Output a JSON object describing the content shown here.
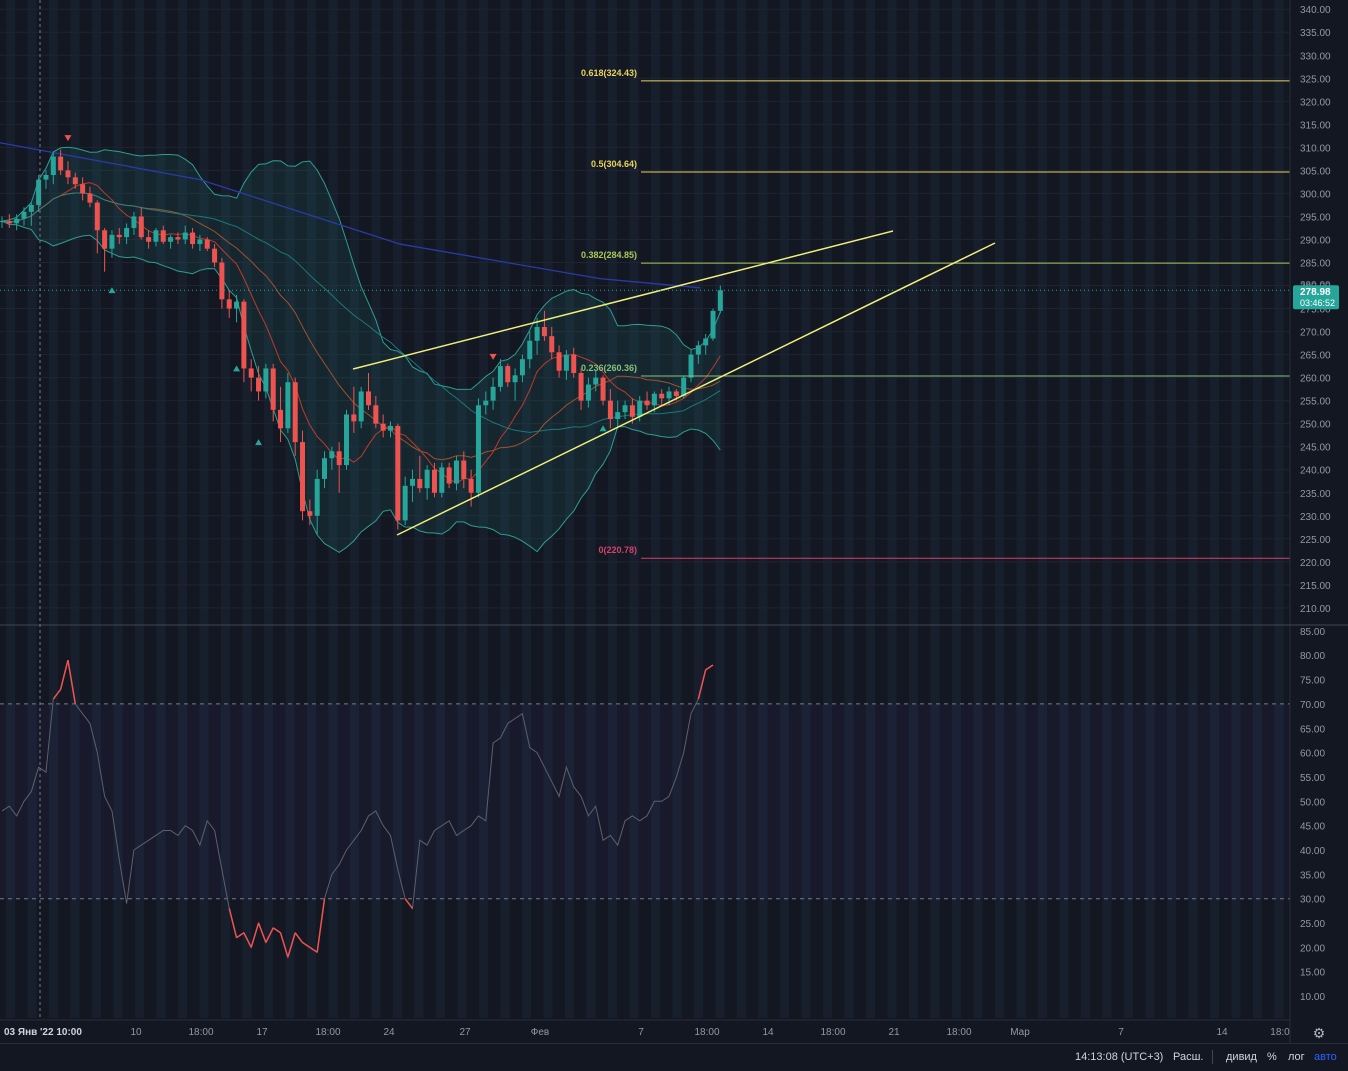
{
  "chart_data": {
    "type": "candlestick",
    "price_axis": {
      "ticks": [
        "340.00",
        "335.00",
        "330.00",
        "325.00",
        "320.00",
        "315.00",
        "310.00",
        "305.00",
        "300.00",
        "295.00",
        "290.00",
        "285.00",
        "280.00",
        "275.00",
        "270.00",
        "265.00",
        "260.00",
        "255.00",
        "250.00",
        "245.00",
        "240.00",
        "235.00",
        "230.00",
        "225.00",
        "220.00",
        "215.00",
        "210.00"
      ],
      "range": [
        206.5,
        342
      ]
    },
    "rsi_axis": {
      "ticks": [
        "85.00",
        "80.00",
        "75.00",
        "70.00",
        "65.00",
        "60.00",
        "55.00",
        "50.00",
        "45.00",
        "40.00",
        "35.00",
        "30.00",
        "25.00",
        "20.00",
        "15.00",
        "10.00"
      ],
      "range": [
        5.5,
        86
      ],
      "overbought": 70,
      "oversold": 30
    },
    "time_axis": {
      "labels": [
        "03 Янв '22 10:00",
        "10",
        "18:00",
        "17",
        "18:00",
        "24",
        "27",
        "Фев",
        "7",
        "18:00",
        "14",
        "18:00",
        "21",
        "18:00",
        "Мар",
        "7",
        "14",
        "18:0"
      ]
    },
    "last_price": {
      "value": "278.98",
      "countdown": "03:46:52",
      "hidden_label": "280.00"
    },
    "fib_levels": [
      {
        "label": "0.618(324.43)",
        "value": 324.43,
        "color": "#e8d35a"
      },
      {
        "label": "0.5(304.64)",
        "value": 304.64,
        "color": "#e8d35a"
      },
      {
        "label": "0.382(284.85)",
        "value": 284.85,
        "color": "#a9c95a"
      },
      {
        "label": "0.236(260.36)",
        "value": 260.36,
        "color": "#86c17a"
      },
      {
        "label": "0(220.78)",
        "value": 220.78,
        "color": "#d4416b"
      }
    ],
    "candles": [
      [
        294,
        295,
        292.5,
        294
      ],
      [
        294,
        295.5,
        292.5,
        293.5
      ],
      [
        293.5,
        295.5,
        292,
        294.5
      ],
      [
        294.5,
        297,
        293,
        296
      ],
      [
        296,
        298,
        293,
        297.5
      ],
      [
        297.5,
        304,
        296,
        303
      ],
      [
        303,
        305,
        301,
        304
      ],
      [
        304,
        309,
        302,
        308
      ],
      [
        308,
        309.5,
        304,
        305
      ],
      [
        305,
        307,
        302,
        303.5
      ],
      [
        303.5,
        304.5,
        301,
        302
      ],
      [
        302,
        303.5,
        298.5,
        300
      ],
      [
        300,
        301.5,
        297,
        298
      ],
      [
        298,
        298.5,
        287,
        292
      ],
      [
        292,
        292.5,
        283,
        288
      ],
      [
        288,
        292,
        286,
        291
      ],
      [
        291,
        292.5,
        289,
        290.5
      ],
      [
        290.5,
        293.5,
        289,
        292.5
      ],
      [
        292.5,
        296,
        291,
        295
      ],
      [
        295,
        297,
        290,
        290.5
      ],
      [
        290.5,
        292,
        288,
        289.5
      ],
      [
        289.5,
        292.5,
        288.5,
        292
      ],
      [
        292,
        293,
        289,
        289.5
      ],
      [
        289.5,
        291,
        288,
        290.5
      ],
      [
        290.5,
        291.5,
        289,
        290
      ],
      [
        290,
        293,
        289,
        291.5
      ],
      [
        291.5,
        292.5,
        288,
        289
      ],
      [
        289,
        291,
        287.5,
        290
      ],
      [
        290,
        290.5,
        287.5,
        288
      ],
      [
        288,
        289,
        284,
        285
      ],
      [
        285,
        286,
        275,
        277
      ],
      [
        277,
        279,
        273,
        275
      ],
      [
        275,
        278,
        272,
        276.5
      ],
      [
        276.5,
        277,
        259,
        262
      ],
      [
        262,
        264,
        257,
        260
      ],
      [
        260,
        262.5,
        255,
        257
      ],
      [
        257,
        263,
        255.5,
        262
      ],
      [
        262,
        263,
        250.5,
        253
      ],
      [
        253,
        258,
        246,
        249
      ],
      [
        249,
        261,
        248,
        259
      ],
      [
        259,
        260,
        243,
        246
      ],
      [
        246,
        248.5,
        229,
        231
      ],
      [
        231,
        233.5,
        228,
        230
      ],
      [
        230,
        240,
        226,
        238
      ],
      [
        238,
        244,
        236,
        242.5
      ],
      [
        242.5,
        245,
        240,
        244
      ],
      [
        244,
        246,
        235,
        241
      ],
      [
        241,
        253,
        240,
        252
      ],
      [
        252,
        258,
        248,
        250.5
      ],
      [
        250.5,
        258,
        249,
        257
      ],
      [
        257,
        261,
        253,
        254
      ],
      [
        254,
        256,
        249,
        250
      ],
      [
        250,
        252,
        247,
        248.5
      ],
      [
        248.5,
        250.5,
        247,
        249.5
      ],
      [
        249.5,
        250,
        227,
        229
      ],
      [
        229,
        238.5,
        228,
        236.5
      ],
      [
        236.5,
        240,
        233,
        238
      ],
      [
        238,
        243,
        235,
        236
      ],
      [
        236,
        241,
        233.5,
        240
      ],
      [
        240,
        241.5,
        234,
        235
      ],
      [
        235,
        241.5,
        234,
        240.5
      ],
      [
        240.5,
        241.5,
        236,
        237
      ],
      [
        237,
        243,
        235.5,
        242
      ],
      [
        242,
        244,
        236,
        238
      ],
      [
        238,
        240,
        232,
        235
      ],
      [
        235,
        255.5,
        234,
        254
      ],
      [
        254,
        257,
        252,
        255
      ],
      [
        255,
        260,
        253,
        258
      ],
      [
        258,
        264,
        257,
        262.5
      ],
      [
        262.5,
        263,
        258,
        259
      ],
      [
        259,
        262,
        255,
        260.5
      ],
      [
        260.5,
        265,
        259,
        264
      ],
      [
        264,
        270,
        262,
        268
      ],
      [
        268,
        273,
        265,
        271
      ],
      [
        271,
        274.5,
        268,
        269
      ],
      [
        269,
        271,
        264,
        265.5
      ],
      [
        265.5,
        267,
        260,
        261.5
      ],
      [
        261.5,
        266,
        259.5,
        265
      ],
      [
        265,
        266.5,
        260,
        261
      ],
      [
        261,
        262,
        253,
        255
      ],
      [
        255,
        260,
        253.5,
        258.5
      ],
      [
        258.5,
        261.5,
        257,
        260
      ],
      [
        260,
        260.5,
        254,
        255
      ],
      [
        255,
        257.5,
        249,
        251
      ],
      [
        251,
        255,
        249,
        252.5
      ],
      [
        252.5,
        255,
        251,
        254
      ],
      [
        254,
        255.5,
        250,
        251.5
      ],
      [
        251.5,
        256,
        250.5,
        255
      ],
      [
        255,
        257,
        253,
        254
      ],
      [
        254,
        257,
        252.5,
        256.5
      ],
      [
        256.5,
        257.5,
        254,
        255.5
      ],
      [
        255.5,
        258,
        254,
        257
      ],
      [
        257,
        257.5,
        255,
        256
      ],
      [
        256,
        260.5,
        255.5,
        260
      ],
      [
        260,
        266,
        259,
        265
      ],
      [
        265,
        268,
        263,
        267
      ],
      [
        267,
        269.5,
        265,
        268.5
      ],
      [
        268.5,
        275,
        268,
        274.5
      ],
      [
        274.5,
        280,
        274,
        278.98
      ]
    ],
    "rsi": [
      48,
      49,
      47,
      50,
      52,
      57,
      56,
      71,
      73,
      79,
      70,
      68,
      66,
      60,
      51,
      48,
      38,
      29,
      40,
      41,
      42,
      43,
      44,
      44,
      43,
      45,
      44,
      41,
      46,
      44,
      36,
      28,
      22,
      23,
      20,
      25,
      21,
      24,
      23,
      18,
      23,
      21,
      20,
      19,
      30,
      35,
      37,
      40,
      42,
      44,
      47,
      48,
      45,
      43,
      36,
      30,
      28,
      42,
      41,
      44,
      45,
      46,
      43,
      44,
      45,
      47,
      46,
      62,
      63,
      66,
      67,
      68,
      61,
      60,
      57,
      54,
      51,
      57,
      53,
      51,
      47,
      49,
      42,
      43,
      41,
      46,
      47,
      46,
      47,
      50,
      50,
      51,
      55,
      60,
      68,
      71,
      77,
      78
    ]
  },
  "bottom_bar": {
    "time": "14:13:08 (UTC+3)",
    "ext": "Расш.",
    "div": "дивид",
    "pct": "%",
    "log": "лог",
    "auto": "авто"
  },
  "icons": {
    "settings": "gear-icon"
  }
}
